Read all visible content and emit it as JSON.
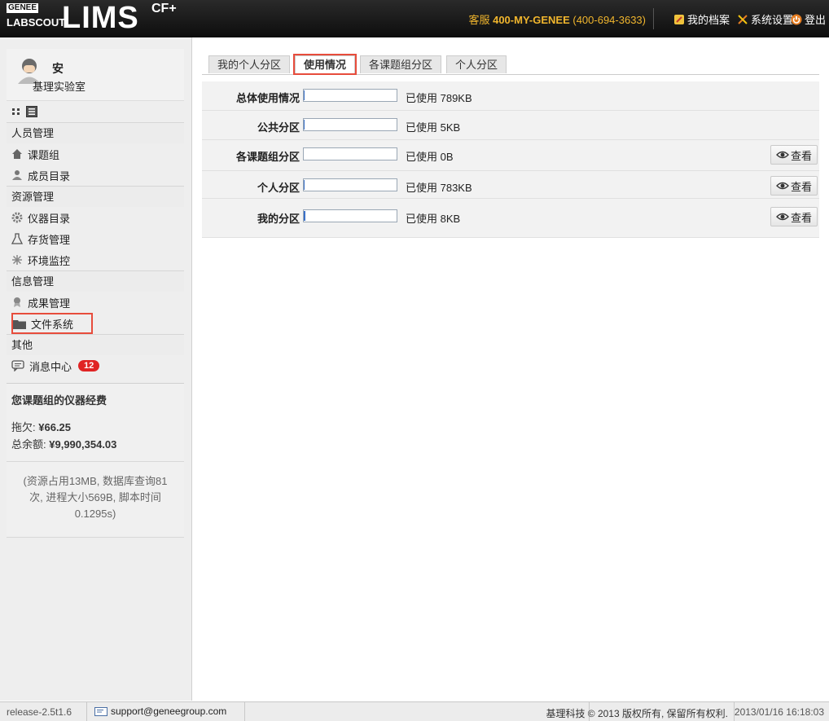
{
  "header": {
    "logo_genee": "GENEE",
    "logo_labscout": "LABSCOUT",
    "logo_lims": "LIMS",
    "logo_cf": "CF+",
    "service_label": "客服",
    "service_number": "400-MY-GENEE",
    "service_alt": "(400-694-3633)",
    "profile_label": "我的档案",
    "settings_label": "系统设置",
    "logout_label": "登出"
  },
  "user": {
    "name": "安",
    "lab": "基理实验室"
  },
  "sidebar": {
    "sections": [
      {
        "title": "人员管理",
        "items": [
          {
            "label": "课题组",
            "icon": "house-icon"
          },
          {
            "label": "成员目录",
            "icon": "person-icon"
          }
        ]
      },
      {
        "title": "资源管理",
        "items": [
          {
            "label": "仪器目录",
            "icon": "gear-icon"
          },
          {
            "label": "存货管理",
            "icon": "flask-icon"
          },
          {
            "label": "环境监控",
            "icon": "snowflake-icon"
          }
        ]
      },
      {
        "title": "信息管理",
        "items": [
          {
            "label": "成果管理",
            "icon": "award-icon"
          },
          {
            "label": "文件系统",
            "icon": "folder-icon"
          }
        ]
      },
      {
        "title": "其他",
        "items": [
          {
            "label": "消息中心",
            "icon": "message-icon",
            "badge": "12"
          }
        ]
      }
    ]
  },
  "funds": {
    "title": "您课题组的仪器经费",
    "owe_label": "拖欠:",
    "owe_value": "¥66.25",
    "balance_label": "总余额:",
    "balance_value": "¥9,990,354.03"
  },
  "sysinfo": "(资源占用13MB, 数据库查询81次, 进程大小569B, 脚本时间0.1295s)",
  "tabs": [
    {
      "label": "我的个人分区",
      "active": false
    },
    {
      "label": "使用情况",
      "active": true
    },
    {
      "label": "各课题组分区",
      "active": false
    },
    {
      "label": "个人分区",
      "active": false
    }
  ],
  "usage": {
    "view_label": "查看",
    "rows": [
      {
        "label": "总体使用情况",
        "used": "已使用 789KB",
        "fill": 0.01,
        "has_view": false
      },
      {
        "label": "公共分区",
        "used": "已使用 5KB",
        "fill": 0.01,
        "has_view": false
      },
      {
        "label": "各课题组分区",
        "used": "已使用 0B",
        "fill": 0.0,
        "has_view": true
      },
      {
        "label": "个人分区",
        "used": "已使用 783KB",
        "fill": 0.01,
        "has_view": true
      },
      {
        "label": "我的分区",
        "used": "已使用 8KB",
        "fill": 0.02,
        "has_view": true
      }
    ]
  },
  "footer": {
    "release": "release-2.5t1.6",
    "email": "support@geneegroup.com",
    "copyright": "基理科技 © 2013 版权所有, 保留所有权利.",
    "timestamp": "2013/01/16 16:18:03"
  },
  "colors": {
    "header_bg": "#111111",
    "accent_orange": "#f0b52d",
    "highlight_red": "#e74c3c",
    "badge_red": "#e02424",
    "bar_fill": "#3a70c8"
  }
}
